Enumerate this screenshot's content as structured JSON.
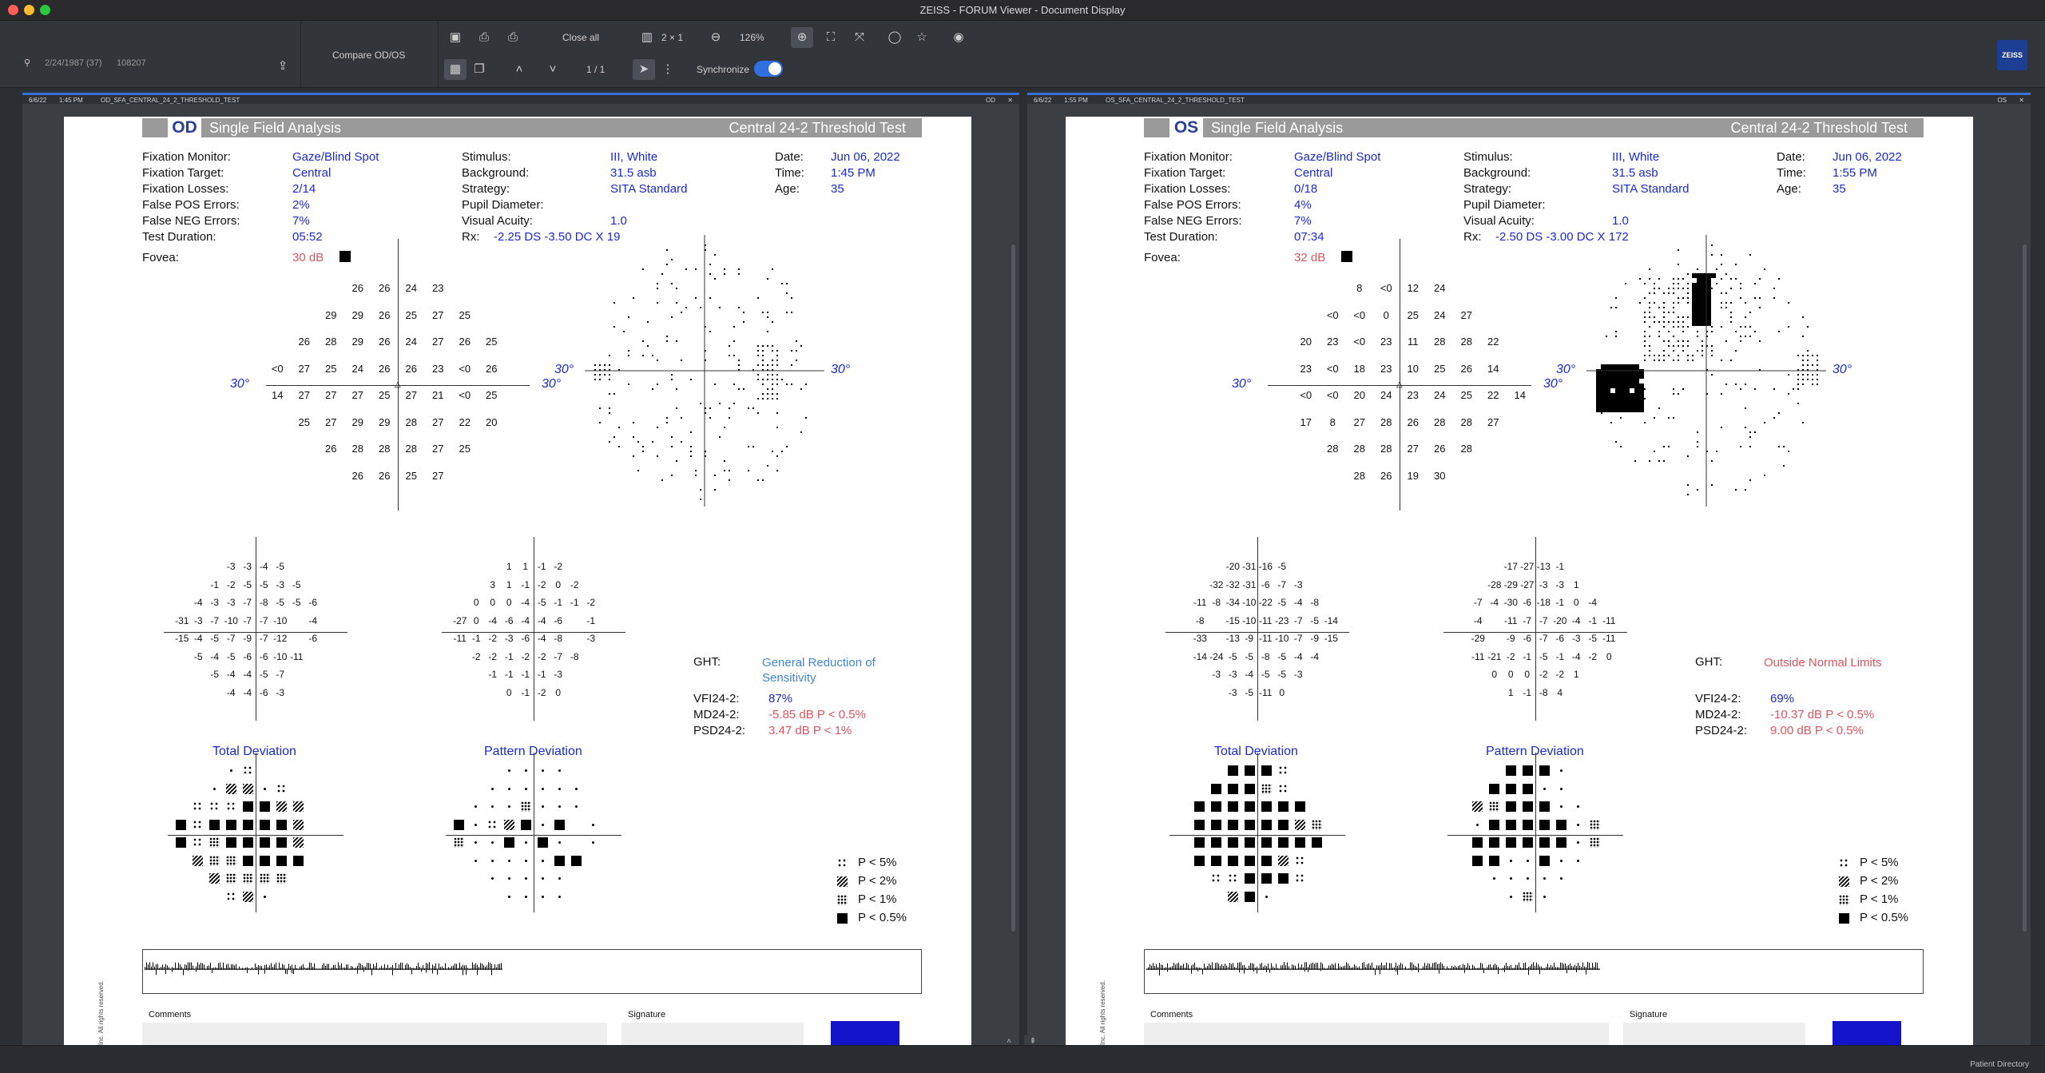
{
  "window": {
    "title": "ZEISS - FORUM Viewer - Document Display"
  },
  "patient": {
    "dob": "2/24/1987 (37)",
    "id": "108207"
  },
  "toolbar": {
    "compare_label": "Compare OD/OS",
    "close_all_label": "Close all",
    "layout_label": "2 × 1",
    "zoom_label": "126%",
    "page_label": "1 / 1",
    "sync_label": "Synchronize",
    "logo_text": "ZEISS"
  },
  "reports": [
    {
      "tab": {
        "date": "6/6/22",
        "time": "1:45 PM",
        "name": "OD_SFA_CENTRAL_24_2_THRESHOLD_TEST",
        "eye": "OD"
      },
      "eye": "OD",
      "analysis": "Single Field Analysis",
      "test": "Central 24-2 Threshold Test",
      "info": {
        "fixation_monitor_label": "Fixation Monitor:",
        "fixation_monitor": "Gaze/Blind Spot",
        "fixation_target_label": "Fixation Target:",
        "fixation_target": "Central",
        "fixation_losses_label": "Fixation Losses:",
        "fixation_losses": "2/14",
        "false_pos_label": "False POS Errors:",
        "false_pos": "2%",
        "false_neg_label": "False NEG Errors:",
        "false_neg": "7%",
        "duration_label": "Test Duration:",
        "duration": "05:52",
        "fovea_label": "Fovea:",
        "fovea": "30 dB",
        "stimulus_label": "Stimulus:",
        "stimulus": "III, White",
        "background_label": "Background:",
        "background": "31.5 asb",
        "strategy_label": "Strategy:",
        "strategy": "SITA Standard",
        "pupil_label": "Pupil Diameter:",
        "pupil": "",
        "acuity_label": "Visual Acuity:",
        "acuity": "1.0",
        "rx_label": "Rx:",
        "rx": "-2.25 DS  -3.50 DC  X 19",
        "date_label": "Date:",
        "date": "Jun 06, 2022",
        "time_label": "Time:",
        "time": "1:45 PM",
        "age_label": "Age:",
        "age": "35"
      },
      "thresholds": [
        [
          "",
          "",
          "",
          "26",
          "26",
          "24",
          "23",
          "",
          "",
          ""
        ],
        [
          "",
          "",
          "29",
          "29",
          "26",
          "25",
          "27",
          "25",
          "",
          ""
        ],
        [
          "",
          "26",
          "28",
          "29",
          "26",
          "24",
          "27",
          "26",
          "25",
          ""
        ],
        [
          "<0",
          "27",
          "25",
          "24",
          "26",
          "26",
          "23",
          "<0",
          "26",
          ""
        ],
        [
          "14",
          "27",
          "27",
          "27",
          "25",
          "27",
          "21",
          "<0",
          "25",
          ""
        ],
        [
          "",
          "25",
          "27",
          "29",
          "29",
          "28",
          "27",
          "22",
          "20",
          ""
        ],
        [
          "",
          "",
          "26",
          "28",
          "28",
          "28",
          "27",
          "25",
          "",
          ""
        ],
        [
          "",
          "",
          "",
          "26",
          "26",
          "25",
          "27",
          "",
          "",
          ""
        ]
      ],
      "total_dev": [
        [
          "",
          "",
          "",
          "-3",
          "-3",
          "-4",
          "-5",
          "",
          "",
          ""
        ],
        [
          "",
          "",
          "-1",
          "-2",
          "-5",
          "-5",
          "-3",
          "-5",
          "",
          ""
        ],
        [
          "",
          "-4",
          "-3",
          "-3",
          "-7",
          "-8",
          "-5",
          "-5",
          "-6",
          ""
        ],
        [
          "-31",
          "-3",
          "-7",
          "-10",
          "-7",
          "-7",
          "-10",
          "",
          "-4",
          ""
        ],
        [
          "-15",
          "-4",
          "-5",
          "-7",
          "-9",
          "-7",
          "-12",
          "",
          "-6",
          ""
        ],
        [
          "",
          "-5",
          "-4",
          "-5",
          "-6",
          "-6",
          "-10",
          "-11",
          "",
          ""
        ],
        [
          "",
          "",
          "-5",
          "-4",
          "-4",
          "-5",
          "-7",
          "",
          "",
          ""
        ],
        [
          "",
          "",
          "",
          "-4",
          "-4",
          "-6",
          "-3",
          "",
          "",
          ""
        ]
      ],
      "pattern_dev": [
        [
          "",
          "",
          "",
          "1",
          "1",
          "-1",
          "-2",
          "",
          "",
          ""
        ],
        [
          "",
          "",
          "3",
          "1",
          "-1",
          "-2",
          "0",
          "-2",
          "",
          ""
        ],
        [
          "",
          "0",
          "0",
          "0",
          "-4",
          "-5",
          "-1",
          "-1",
          "-2",
          ""
        ],
        [
          "-27",
          "0",
          "-4",
          "-6",
          "-4",
          "-4",
          "-6",
          "",
          "-1",
          ""
        ],
        [
          "-11",
          "-1",
          "-2",
          "-3",
          "-6",
          "-4",
          "-8",
          "",
          "-3",
          ""
        ],
        [
          "",
          "-2",
          "-2",
          "-1",
          "-2",
          "-2",
          "-7",
          "-8",
          "",
          ""
        ],
        [
          "",
          "",
          "-1",
          "-1",
          "-1",
          "-1",
          "-3",
          "",
          "",
          ""
        ],
        [
          "",
          "",
          "",
          "0",
          "-1",
          "-2",
          "0",
          "",
          "",
          ""
        ]
      ],
      "total_dev_probs": [
        [
          "",
          "",
          "",
          "dot",
          "s5",
          "",
          "",
          "",
          "",
          ""
        ],
        [
          "",
          "",
          "dot",
          "s2",
          "s2",
          "dot",
          "s5",
          "",
          "",
          ""
        ],
        [
          "",
          "s5",
          "s5",
          "s5",
          "s05",
          "s05",
          "s2",
          "s2",
          "",
          ""
        ],
        [
          "s05",
          "s5",
          "s05",
          "s05",
          "s05",
          "s05",
          "s05",
          "s2",
          "",
          ""
        ],
        [
          "s05",
          "s5",
          "s1",
          "s05",
          "s05",
          "s05",
          "s05",
          "s2",
          "",
          ""
        ],
        [
          "",
          "s2",
          "s1",
          "s1",
          "s05",
          "s05",
          "s05",
          "s05",
          "",
          ""
        ],
        [
          "",
          "",
          "s2",
          "s1",
          "s1",
          "s1",
          "s1",
          "",
          "",
          ""
        ],
        [
          "",
          "",
          "",
          "s5",
          "s2",
          "dot",
          "",
          "",
          "",
          ""
        ]
      ],
      "pattern_dev_probs": [
        [
          "",
          "",
          "",
          "dot",
          "dot",
          "dot",
          "dot",
          "",
          "",
          ""
        ],
        [
          "",
          "",
          "dot",
          "dot",
          "dot",
          "dot",
          "dot",
          "dot",
          "",
          ""
        ],
        [
          "",
          "dot",
          "dot",
          "dot",
          "s1",
          "dot",
          "dot",
          "dot",
          "",
          ""
        ],
        [
          "s05",
          "dot",
          "s5",
          "s2",
          "s05",
          "dot",
          "s05",
          "",
          "dot",
          ""
        ],
        [
          "s1",
          "dot",
          "dot",
          "s05",
          "dot",
          "s05",
          "dot",
          "",
          "dot",
          ""
        ],
        [
          "",
          "dot",
          "dot",
          "dot",
          "dot",
          "dot",
          "s05",
          "s05",
          "",
          ""
        ],
        [
          "",
          "",
          "dot",
          "dot",
          "dot",
          "dot",
          "dot",
          "",
          "",
          ""
        ],
        [
          "",
          "",
          "",
          "dot",
          "dot",
          "dot",
          "dot",
          "",
          "",
          ""
        ]
      ],
      "total_dev_title": "Total Deviation",
      "pattern_dev_title": "Pattern Deviation",
      "ght_label": "GHT:",
      "ght": "General Reduction of Sensitivity",
      "ght_color": "lightblue",
      "vfi_label": "VFI24-2:",
      "vfi": "87%",
      "md_label": "MD24-2:",
      "md": "-5.85 dB P < 0.5%",
      "psd_label": "PSD24-2:",
      "psd": "3.47 dB P < 1%",
      "legend": [
        "P < 5%",
        "P < 2%",
        "P < 1%",
        "P < 0.5%"
      ],
      "degree_label": "30°",
      "comments_label": "Comments",
      "signature_label": "Signature",
      "copyright": "Inc. All rights reserved.",
      "gray": {
        "blind_spot_side": "left",
        "scotoma": "light"
      }
    },
    {
      "tab": {
        "date": "6/6/22",
        "time": "1:55 PM",
        "name": "OS_SFA_CENTRAL_24_2_THRESHOLD_TEST",
        "eye": "OS"
      },
      "eye": "OS",
      "analysis": "Single Field Analysis",
      "test": "Central 24-2 Threshold Test",
      "info": {
        "fixation_monitor_label": "Fixation Monitor:",
        "fixation_monitor": "Gaze/Blind Spot",
        "fixation_target_label": "Fixation Target:",
        "fixation_target": "Central",
        "fixation_losses_label": "Fixation Losses:",
        "fixation_losses": "0/18",
        "false_pos_label": "False POS Errors:",
        "false_pos": "4%",
        "false_neg_label": "False NEG Errors:",
        "false_neg": "7%",
        "duration_label": "Test Duration:",
        "duration": "07:34",
        "fovea_label": "Fovea:",
        "fovea": "32 dB",
        "stimulus_label": "Stimulus:",
        "stimulus": "III, White",
        "background_label": "Background:",
        "background": "31.5 asb",
        "strategy_label": "Strategy:",
        "strategy": "SITA Standard",
        "pupil_label": "Pupil Diameter:",
        "pupil": "",
        "acuity_label": "Visual Acuity:",
        "acuity": "1.0",
        "rx_label": "Rx:",
        "rx": "-2.50 DS  -3.00 DC  X 172",
        "date_label": "Date:",
        "date": "Jun 06, 2022",
        "time_label": "Time:",
        "time": "1:55 PM",
        "age_label": "Age:",
        "age": "35"
      },
      "thresholds": [
        [
          "",
          "",
          "",
          "8",
          "<0",
          "12",
          "24",
          "",
          "",
          ""
        ],
        [
          "",
          "",
          "<0",
          "<0",
          "0",
          "25",
          "24",
          "27",
          "",
          ""
        ],
        [
          "",
          "20",
          "23",
          "<0",
          "23",
          "11",
          "28",
          "28",
          "22",
          ""
        ],
        [
          "",
          "23",
          "<0",
          "18",
          "23",
          "10",
          "25",
          "26",
          "14",
          ""
        ],
        [
          "",
          "<0",
          "<0",
          "20",
          "24",
          "23",
          "24",
          "25",
          "22",
          "14"
        ],
        [
          "",
          "17",
          "8",
          "27",
          "28",
          "26",
          "28",
          "28",
          "27",
          ""
        ],
        [
          "",
          "",
          "28",
          "28",
          "28",
          "27",
          "26",
          "28",
          "",
          ""
        ],
        [
          "",
          "",
          "",
          "28",
          "26",
          "19",
          "30",
          "",
          "",
          ""
        ]
      ],
      "total_dev": [
        [
          "",
          "",
          "",
          "-20",
          "-31",
          "-16",
          "-5",
          "",
          "",
          ""
        ],
        [
          "",
          "",
          "-32",
          "-32",
          "-31",
          "-6",
          "-7",
          "-3",
          "",
          ""
        ],
        [
          "",
          "-11",
          "-8",
          "-34",
          "-10",
          "-22",
          "-5",
          "-4",
          "-8",
          ""
        ],
        [
          "",
          "-8",
          "",
          "-15",
          "-10",
          "-11",
          "-23",
          "-7",
          "-5",
          "-14"
        ],
        [
          "",
          "-33",
          "",
          "-13",
          "-9",
          "-11",
          "-10",
          "-7",
          "-9",
          "-15"
        ],
        [
          "",
          "-14",
          "-24",
          "-5",
          "-5",
          "-8",
          "-5",
          "-4",
          "-4",
          ""
        ],
        [
          "",
          "",
          "-3",
          "-3",
          "-4",
          "-5",
          "-5",
          "-3",
          "",
          ""
        ],
        [
          "",
          "",
          "",
          "-3",
          "-5",
          "-11",
          "0",
          "",
          "",
          ""
        ]
      ],
      "pattern_dev": [
        [
          "",
          "",
          "",
          "-17",
          "-27",
          "-13",
          "-1",
          "",
          "",
          ""
        ],
        [
          "",
          "",
          "-28",
          "-29",
          "-27",
          "-3",
          "-3",
          "1",
          "",
          ""
        ],
        [
          "",
          "-7",
          "-4",
          "-30",
          "-6",
          "-18",
          "-1",
          "0",
          "-4",
          ""
        ],
        [
          "",
          "-4",
          "",
          "-11",
          "-7",
          "-7",
          "-20",
          "-4",
          "-1",
          "-11"
        ],
        [
          "",
          "-29",
          "",
          "-9",
          "-6",
          "-7",
          "-6",
          "-3",
          "-5",
          "-11"
        ],
        [
          "",
          "-11",
          "-21",
          "-2",
          "-1",
          "-5",
          "-1",
          "-4",
          "-2",
          "0"
        ],
        [
          "",
          "",
          "0",
          "0",
          "0",
          "-2",
          "-2",
          "1",
          "",
          ""
        ],
        [
          "",
          "",
          "",
          "1",
          "-1",
          "-8",
          "4",
          "",
          "",
          ""
        ]
      ],
      "total_dev_probs": [
        [
          "",
          "",
          "",
          "s05",
          "s05",
          "s05",
          "s5",
          "",
          "",
          ""
        ],
        [
          "",
          "",
          "s05",
          "s05",
          "s05",
          "s1",
          "s5",
          "",
          "",
          ""
        ],
        [
          "",
          "s05",
          "s05",
          "s05",
          "s05",
          "s05",
          "s05",
          "s05",
          "",
          ""
        ],
        [
          "",
          "s05",
          "s05",
          "s05",
          "s05",
          "s05",
          "s05",
          "s2",
          "s1",
          ""
        ],
        [
          "",
          "s05",
          "s05",
          "s05",
          "s05",
          "s05",
          "s05",
          "s05",
          "s05",
          ""
        ],
        [
          "",
          "s05",
          "s05",
          "s05",
          "s05",
          "s05",
          "s2",
          "s5",
          "",
          ""
        ],
        [
          "",
          "",
          "s5",
          "s5",
          "s05",
          "s05",
          "s05",
          "s5",
          "",
          ""
        ],
        [
          "",
          "",
          "",
          "s2",
          "s05",
          "dot",
          "",
          "",
          "",
          ""
        ]
      ],
      "pattern_dev_probs": [
        [
          "",
          "",
          "",
          "s05",
          "s05",
          "s05",
          "dot",
          "",
          "",
          ""
        ],
        [
          "",
          "",
          "s05",
          "s05",
          "s05",
          "dot",
          "dot",
          "",
          "",
          ""
        ],
        [
          "",
          "s2",
          "s1",
          "s05",
          "s05",
          "s05",
          "dot",
          "dot",
          "",
          ""
        ],
        [
          "",
          "dot",
          "s05",
          "s05",
          "s05",
          "s05",
          "s05",
          "dot",
          "s1",
          ""
        ],
        [
          "",
          "s05",
          "s05",
          "s05",
          "s05",
          "s05",
          "s05",
          "dot",
          "s1",
          ""
        ],
        [
          "",
          "s05",
          "s05",
          "dot",
          "dot",
          "s05",
          "dot",
          "dot",
          "",
          ""
        ],
        [
          "",
          "",
          "dot",
          "dot",
          "dot",
          "dot",
          "dot",
          "",
          "",
          ""
        ],
        [
          "",
          "",
          "",
          "dot",
          "s1",
          "dot",
          "",
          "",
          "",
          ""
        ]
      ],
      "total_dev_title": "Total Deviation",
      "pattern_dev_title": "Pattern Deviation",
      "ght_label": "GHT:",
      "ght": "Outside Normal Limits",
      "ght_color": "red",
      "vfi_label": "VFI24-2:",
      "vfi": "69%",
      "md_label": "MD24-2:",
      "md": "-10.37 dB P < 0.5%",
      "psd_label": "PSD24-2:",
      "psd": "9.00 dB P < 0.5%",
      "legend": [
        "P < 5%",
        "P < 2%",
        "P < 1%",
        "P < 0.5%"
      ],
      "degree_label": "30°",
      "comments_label": "Comments",
      "signature_label": "Signature",
      "copyright": "Inc. All rights reserved.",
      "gray": {
        "blind_spot_side": "right",
        "scotoma": "heavy"
      }
    }
  ],
  "footer": {
    "patient_directory": "Patient Directory"
  }
}
